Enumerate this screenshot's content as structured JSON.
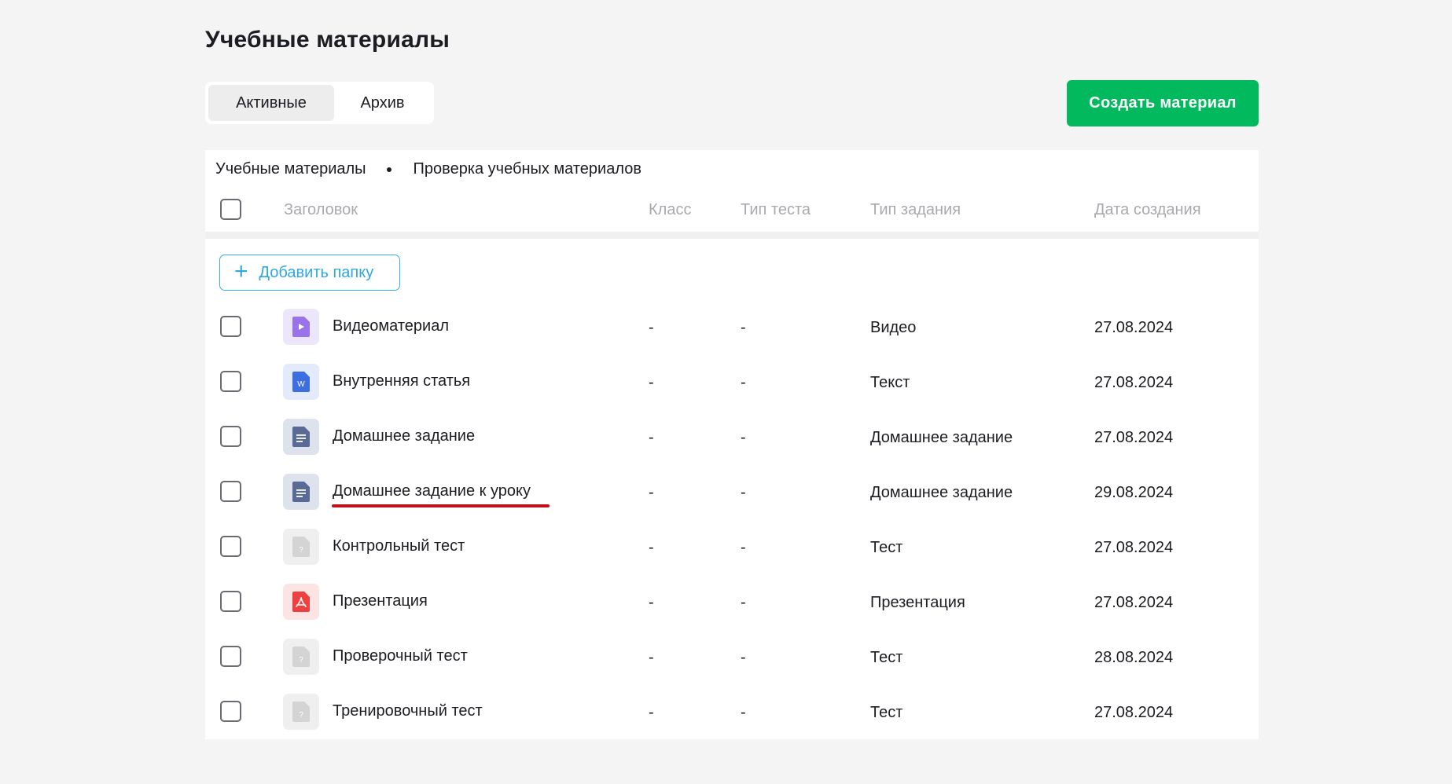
{
  "page": {
    "title": "Учебные материалы"
  },
  "tabs": [
    {
      "label": "Активные",
      "active": true
    },
    {
      "label": "Архив",
      "active": false
    }
  ],
  "create_button": {
    "label": "Создать материал",
    "color": "#03b95e"
  },
  "breadcrumb": {
    "items": [
      "Учебные материалы",
      "Проверка учебных материалов"
    ]
  },
  "table": {
    "headers": {
      "title": "Заголовок",
      "klass": "Класс",
      "test_type": "Тип теста",
      "task_type": "Тип задания",
      "created": "Дата создания"
    },
    "add_folder_label": "Добавить папку",
    "rows": [
      {
        "icon": "video-file-icon",
        "title": "Видеоматериал",
        "klass": "-",
        "test_type": "-",
        "task_type": "Видео",
        "created": "27.08.2024"
      },
      {
        "icon": "word-file-icon",
        "title": "Внутренняя статья",
        "klass": "-",
        "test_type": "-",
        "task_type": "Текст",
        "created": "27.08.2024"
      },
      {
        "icon": "document-file-icon",
        "title": "Домашнее задание",
        "klass": "-",
        "test_type": "-",
        "task_type": "Домашнее задание",
        "created": "27.08.2024"
      },
      {
        "icon": "document-file-icon",
        "title": "Домашнее задание к уроку",
        "klass": "-",
        "test_type": "-",
        "task_type": "Домашнее задание",
        "created": "29.08.2024",
        "highlighted": true
      },
      {
        "icon": "test-file-icon",
        "title": "Контрольный тест",
        "klass": "-",
        "test_type": "-",
        "task_type": "Тест",
        "created": "27.08.2024"
      },
      {
        "icon": "pdf-file-icon",
        "title": "Презентация",
        "klass": "-",
        "test_type": "-",
        "task_type": "Презентация",
        "created": "27.08.2024"
      },
      {
        "icon": "test-file-icon",
        "title": "Проверочный тест",
        "klass": "-",
        "test_type": "-",
        "task_type": "Тест",
        "created": "28.08.2024"
      },
      {
        "icon": "test-file-icon",
        "title": "Тренировочный тест",
        "klass": "-",
        "test_type": "-",
        "task_type": "Тест",
        "created": "27.08.2024"
      }
    ]
  },
  "colors": {
    "accent_green": "#03b95e",
    "link_blue": "#2ea7e3",
    "highlight_red": "#c40f1a"
  }
}
